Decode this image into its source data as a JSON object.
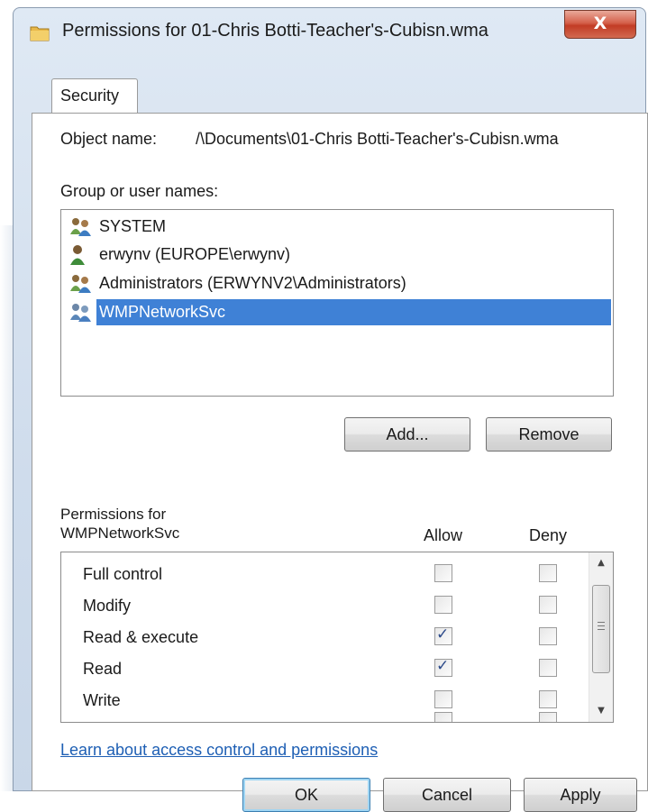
{
  "window": {
    "title": "Permissions for 01-Chris Botti-Teacher's-Cubisn.wma",
    "close_label": "X"
  },
  "tabs": [
    {
      "label": "Security"
    }
  ],
  "object": {
    "label": "Object name:",
    "value": "/\\Documents\\01-Chris Botti-Teacher's-Cubisn.wma"
  },
  "groups": {
    "label": "Group or user names:",
    "items": [
      {
        "name": "SYSTEM",
        "icon": "users-group-icon"
      },
      {
        "name": "erwynv (EUROPE\\erwynv)",
        "icon": "user-icon"
      },
      {
        "name": "Administrators (ERWYNV2\\Administrators)",
        "icon": "users-group-icon"
      },
      {
        "name": "WMPNetworkSvc",
        "icon": "users-group-icon",
        "selected": true
      }
    ],
    "add_label": "Add...",
    "remove_label": "Remove"
  },
  "permissions": {
    "label_line1": "Permissions for",
    "label_line2": "WMPNetworkSvc",
    "allow_header": "Allow",
    "deny_header": "Deny",
    "rows": [
      {
        "label": "Full control",
        "allow": false,
        "deny": false
      },
      {
        "label": "Modify",
        "allow": false,
        "deny": false
      },
      {
        "label": "Read & execute",
        "allow": true,
        "deny": false
      },
      {
        "label": "Read",
        "allow": true,
        "deny": false
      },
      {
        "label": "Write",
        "allow": false,
        "deny": false
      }
    ]
  },
  "link": {
    "label": "Learn about access control and permissions"
  },
  "footer": {
    "ok_label": "OK",
    "cancel_label": "Cancel",
    "apply_label": "Apply"
  }
}
